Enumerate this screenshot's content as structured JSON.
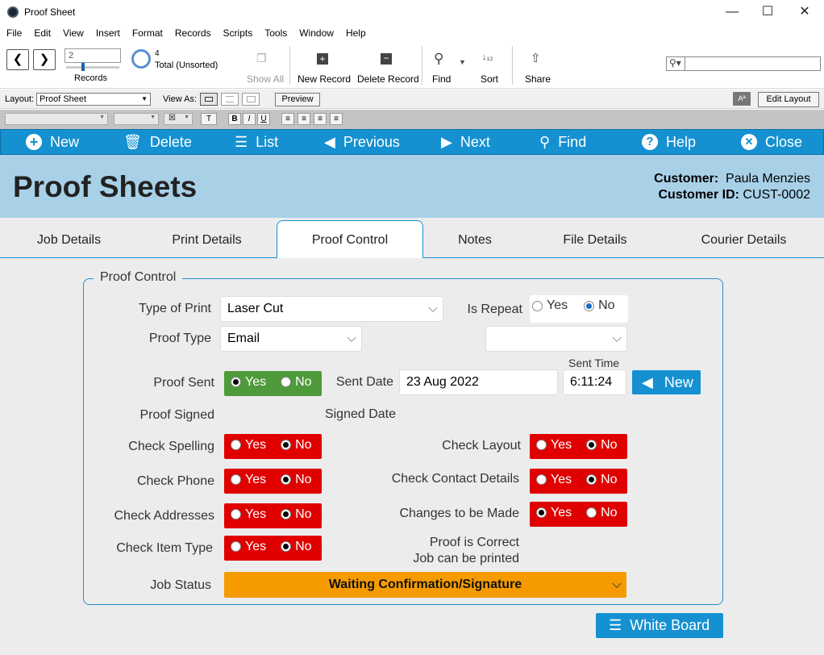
{
  "window": {
    "title": "Proof Sheet",
    "minimize": "—",
    "maximize": "☐",
    "close": "✕"
  },
  "menu": [
    "File",
    "Edit",
    "View",
    "Insert",
    "Format",
    "Records",
    "Scripts",
    "Tools",
    "Window",
    "Help"
  ],
  "toolbar": {
    "record_value": "2",
    "records_label": "Records",
    "total_count": "4",
    "total_label": "Total (Unsorted)",
    "show_all": "Show All",
    "new_record": "New Record",
    "delete_record": "Delete Record",
    "find": "Find",
    "sort": "Sort",
    "share": "Share",
    "search_placeholder": ""
  },
  "layoutbar": {
    "layout_label": "Layout:",
    "layout_value": "Proof Sheet",
    "view_as_label": "View As:",
    "preview": "Preview",
    "aa": "Aª",
    "edit_layout": "Edit Layout"
  },
  "nav": {
    "new": "New",
    "delete": "Delete",
    "list": "List",
    "previous": "Previous",
    "next": "Next",
    "find": "Find",
    "help": "Help",
    "close": "Close"
  },
  "header": {
    "title": "Proof Sheets",
    "customer_label": "Customer:",
    "customer_value": "Paula Menzies",
    "customer_id_label": "Customer ID:",
    "customer_id_value": "CUST-0002"
  },
  "tabs": [
    "Job Details",
    "Print Details",
    "Proof Control",
    "Notes",
    "File Details",
    "Courier Details"
  ],
  "active_tab": "Proof Control",
  "form": {
    "group_title": "Proof Control",
    "type_of_print_label": "Type of Print",
    "type_of_print_value": "Laser Cut",
    "is_repeat_label": "Is Repeat",
    "is_repeat_yes": "Yes",
    "is_repeat_no": "No",
    "is_repeat_selected": "No",
    "proof_type_label": "Proof Type",
    "proof_type_value": "Email",
    "proof_sent_label": "Proof Sent",
    "sent_date_label": "Sent Date",
    "sent_date_value": "23 Aug 2022",
    "sent_time_label": "Sent Time",
    "sent_time_value": "6:11:24",
    "new_button": "New",
    "proof_signed_label": "Proof Signed",
    "signed_date_label": "Signed Date",
    "check_spelling_label": "Check Spelling",
    "check_phone_label": "Check Phone",
    "check_addresses_label": "Check Addresses",
    "check_item_type_label": "Check Item Type",
    "check_layout_label": "Check Layout",
    "check_contact_label": "Check Contact Details",
    "changes_label": "Changes to be Made",
    "proof_correct_line1": "Proof is Correct",
    "proof_correct_line2": "Job can be printed",
    "job_status_label": "Job Status",
    "job_status_value": "Waiting Confirmation/Signature",
    "yes": "Yes",
    "no": "No",
    "status_colors": {
      "yes_selected": "#4f9a3a",
      "no_selected": "#e00000",
      "pending": "#f59b00"
    }
  },
  "white_board": "White Board"
}
